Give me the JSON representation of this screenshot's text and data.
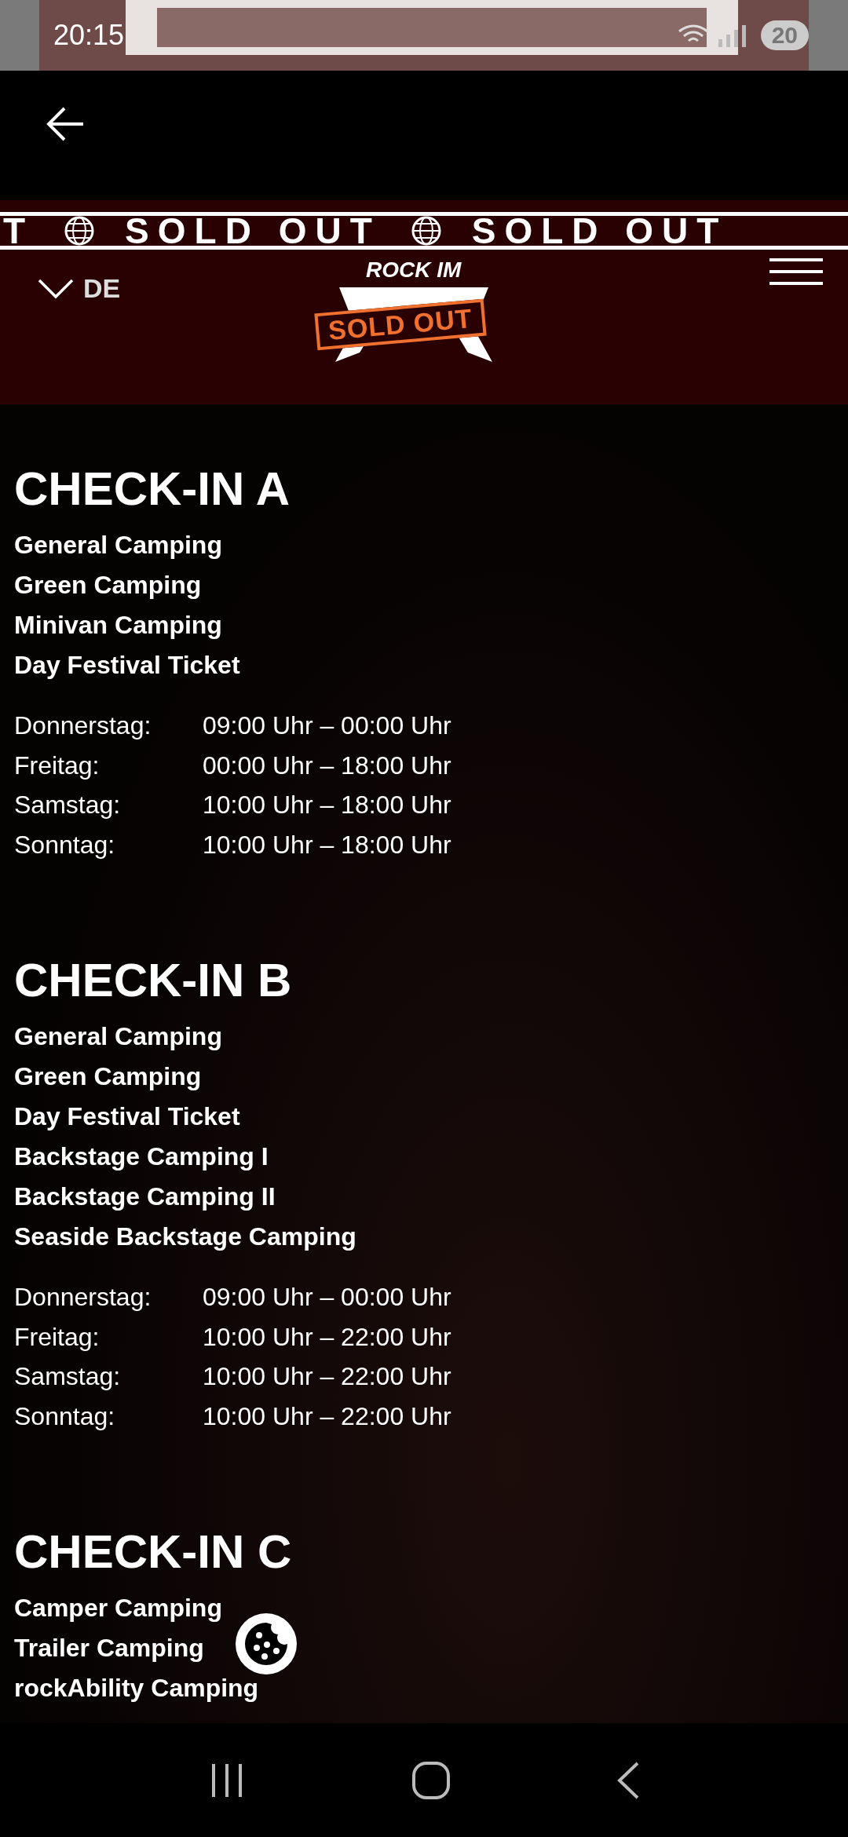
{
  "status_bar": {
    "time": "20:15",
    "battery": "20"
  },
  "ticker": [
    "T",
    "SOLD OUT",
    "SOLD OUT"
  ],
  "header": {
    "language": "DE",
    "logo_text": "ROCK IM",
    "logo_badge": "SOLD OUT"
  },
  "sections": [
    {
      "title": "CHECK-IN A",
      "categories": [
        "General Camping",
        "Green Camping",
        "Minivan Camping",
        "Day Festival Ticket"
      ],
      "hours": [
        {
          "day": "Donnerstag:",
          "time": "09:00 Uhr – 00:00 Uhr"
        },
        {
          "day": "Freitag:",
          "time": "00:00 Uhr – 18:00 Uhr"
        },
        {
          "day": "Samstag:",
          "time": "10:00 Uhr – 18:00 Uhr"
        },
        {
          "day": "Sonntag:",
          "time": "10:00 Uhr – 18:00 Uhr"
        }
      ]
    },
    {
      "title": "CHECK-IN B",
      "categories": [
        "General Camping",
        "Green Camping",
        "Day Festival Ticket",
        "Backstage Camping I",
        "Backstage Camping II",
        "Seaside Backstage Camping"
      ],
      "hours": [
        {
          "day": "Donnerstag:",
          "time": "09:00 Uhr – 00:00 Uhr"
        },
        {
          "day": "Freitag:",
          "time": "10:00 Uhr – 22:00 Uhr"
        },
        {
          "day": "Samstag:",
          "time": "10:00 Uhr – 22:00 Uhr"
        },
        {
          "day": "Sonntag:",
          "time": "10:00 Uhr – 22:00 Uhr"
        }
      ]
    },
    {
      "title": "CHECK-IN C",
      "categories": [
        "Camper Camping",
        "Trailer Camping",
        "rockAbility Camping"
      ]
    }
  ]
}
